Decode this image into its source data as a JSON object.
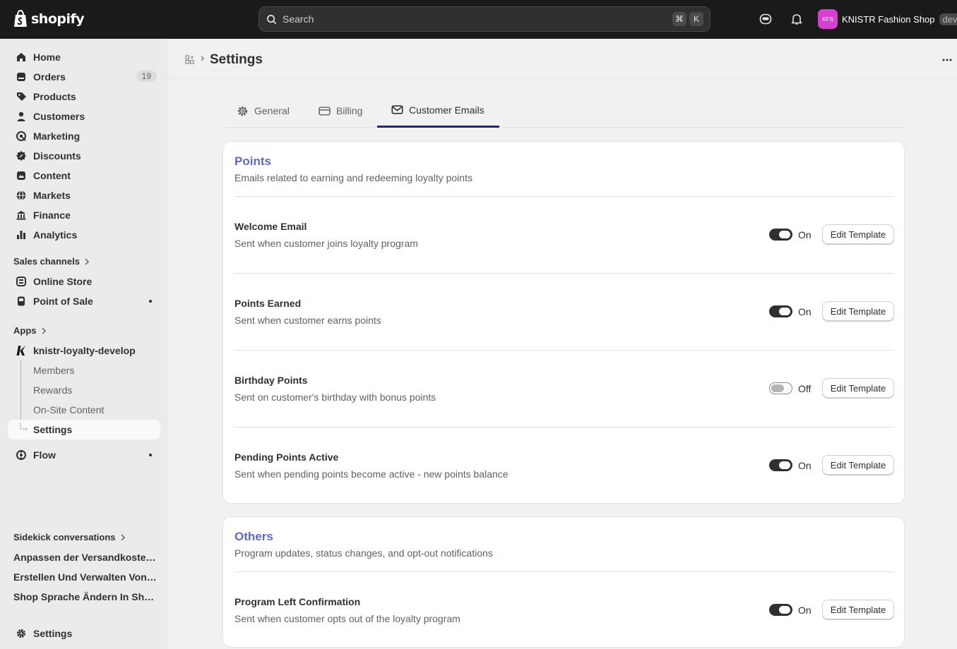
{
  "topbar": {
    "logo_text": "shopify",
    "search_placeholder": "Search",
    "shortcut_keys": [
      "⌘",
      "K"
    ],
    "shop_initials": "KFS",
    "shop_name": "KNISTR Fashion Shop",
    "env_badge": "dev",
    "colors": {
      "bar": "#1a1a1a",
      "avatar": "#d63fd0"
    }
  },
  "sidebar": {
    "main_items": [
      {
        "label": "Home",
        "icon": "home-icon"
      },
      {
        "label": "Orders",
        "icon": "orders-icon",
        "count": "19"
      },
      {
        "label": "Products",
        "icon": "tag-icon"
      },
      {
        "label": "Customers",
        "icon": "person-icon"
      },
      {
        "label": "Marketing",
        "icon": "target-icon"
      },
      {
        "label": "Discounts",
        "icon": "discount-icon"
      },
      {
        "label": "Content",
        "icon": "content-icon"
      },
      {
        "label": "Markets",
        "icon": "globe-icon"
      },
      {
        "label": "Finance",
        "icon": "bank-icon"
      },
      {
        "label": "Analytics",
        "icon": "bar-chart-icon"
      }
    ],
    "sales_channels_heading": "Sales channels",
    "sales_channels": [
      {
        "label": "Online Store",
        "icon": "store-icon"
      },
      {
        "label": "Point of Sale",
        "icon": "pos-icon"
      }
    ],
    "apps_heading": "Apps",
    "app_name": "knistr-loyalty-develop",
    "app_items": [
      "Members",
      "Rewards",
      "On-Site Content",
      "Settings"
    ],
    "flow_label": "Flow",
    "sidekick_heading": "Sidekick conversations",
    "sidekick_items": [
      "Anpassen der Versandkosten in Shopify",
      "Erstellen Und Verwalten Von Kunden",
      "Shop Sprache Ändern In Shopify"
    ],
    "settings_label": "Settings"
  },
  "page": {
    "title": "Settings",
    "tabs": [
      {
        "label": "General",
        "icon": "gear-icon"
      },
      {
        "label": "Billing",
        "icon": "credit-card-icon"
      },
      {
        "label": "Customer Emails",
        "icon": "envelope-icon",
        "active": true
      }
    ],
    "edit_label": "Edit Template",
    "on_label": "On",
    "off_label": "Off"
  },
  "sections": [
    {
      "title": "Points",
      "description": "Emails related to earning and redeeming loyalty points",
      "emails": [
        {
          "title": "Welcome Email",
          "description": "Sent when customer joins loyalty program",
          "enabled": true
        },
        {
          "title": "Points Earned",
          "description": "Sent when customer earns points",
          "enabled": true
        },
        {
          "title": "Birthday Points",
          "description": "Sent on customer's birthday with bonus points",
          "enabled": false
        },
        {
          "title": "Pending Points Active",
          "description": "Sent when pending points become active - new points balance",
          "enabled": true
        }
      ]
    },
    {
      "title": "Others",
      "description": "Program updates, status changes, and opt-out notifications",
      "emails": [
        {
          "title": "Program Left Confirmation",
          "description": "Sent when customer opts out of the loyalty program",
          "enabled": true
        }
      ]
    }
  ],
  "colors": {
    "section_title": "#6466c2",
    "tab_indicator": "#1e2876"
  }
}
